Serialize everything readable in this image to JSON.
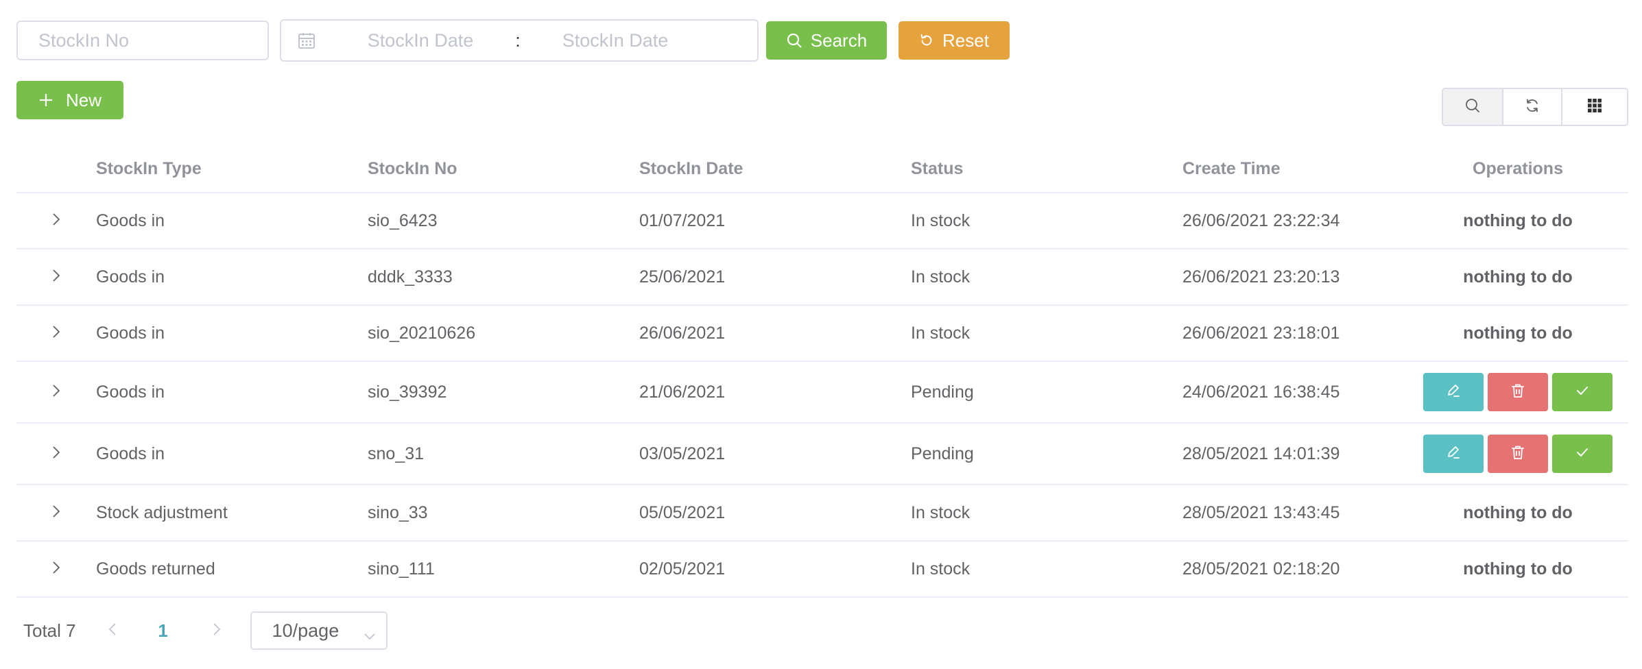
{
  "filters": {
    "stockin_no_placeholder": "StockIn No",
    "date_start_placeholder": "StockIn Date",
    "date_separator": ":",
    "date_end_placeholder": "StockIn Date",
    "search_label": "Search",
    "reset_label": "Reset"
  },
  "toolbar": {
    "new_label": "New",
    "tools": [
      "search-icon",
      "refresh-icon",
      "grid-icon"
    ]
  },
  "table": {
    "columns": [
      "StockIn Type",
      "StockIn No",
      "StockIn Date",
      "Status",
      "Create Time",
      "Operations"
    ],
    "rows": [
      {
        "type": "Goods in",
        "no": "sio_6423",
        "date": "01/07/2021",
        "status": "In stock",
        "created": "26/06/2021 23:22:34",
        "ops": "nothing to do"
      },
      {
        "type": "Goods in",
        "no": "dddk_3333",
        "date": "25/06/2021",
        "status": "In stock",
        "created": "26/06/2021 23:20:13",
        "ops": "nothing to do"
      },
      {
        "type": "Goods in",
        "no": "sio_20210626",
        "date": "26/06/2021",
        "status": "In stock",
        "created": "26/06/2021 23:18:01",
        "ops": "nothing to do"
      },
      {
        "type": "Goods in",
        "no": "sio_39392",
        "date": "21/06/2021",
        "status": "Pending",
        "created": "24/06/2021 16:38:45",
        "ops": ""
      },
      {
        "type": "Goods in",
        "no": "sno_31",
        "date": "03/05/2021",
        "status": "Pending",
        "created": "28/05/2021 14:01:39",
        "ops": ""
      },
      {
        "type": "Stock adjustment",
        "no": "sino_33",
        "date": "05/05/2021",
        "status": "In stock",
        "created": "28/05/2021 13:43:45",
        "ops": "nothing to do"
      },
      {
        "type": "Goods returned",
        "no": "sino_111",
        "date": "02/05/2021",
        "status": "In stock",
        "created": "28/05/2021 02:18:20",
        "ops": "nothing to do"
      }
    ]
  },
  "pagination": {
    "total_label": "Total 7",
    "current_page": "1",
    "page_size": "10/page"
  },
  "colors": {
    "primary_green": "#78bf4c",
    "warning_orange": "#e6a23c",
    "edit_teal": "#5bc0c4",
    "delete_red": "#e57373"
  }
}
